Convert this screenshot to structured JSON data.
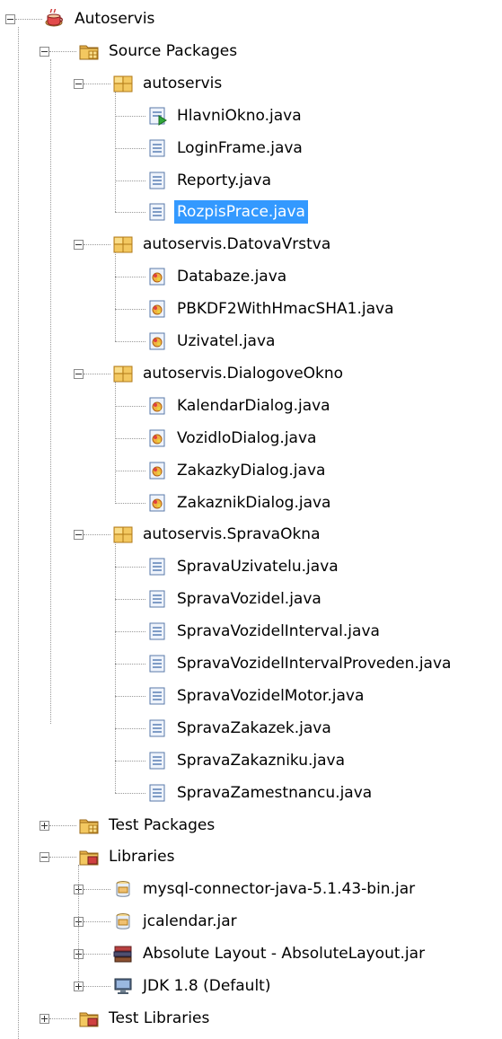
{
  "project": {
    "label": "Autoservis",
    "icon": "coffee-cup-project-icon"
  },
  "source_packages": {
    "label": "Source Packages",
    "icon": "source-packages-folder-icon",
    "packages": [
      {
        "label": "autoservis",
        "files": [
          {
            "label": "HlavniOkno.java",
            "icon": "main-class-icon"
          },
          {
            "label": "LoginFrame.java",
            "icon": "java-form-icon"
          },
          {
            "label": "Reporty.java",
            "icon": "java-form-icon"
          },
          {
            "label": "RozpisPrace.java",
            "icon": "java-form-icon",
            "selected": true
          }
        ]
      },
      {
        "label": "autoservis.DatovaVrstva",
        "files": [
          {
            "label": "Databaze.java",
            "icon": "java-class-icon"
          },
          {
            "label": "PBKDF2WithHmacSHA1.java",
            "icon": "java-class-icon"
          },
          {
            "label": "Uzivatel.java",
            "icon": "java-class-icon"
          }
        ]
      },
      {
        "label": "autoservis.DialogoveOkno",
        "files": [
          {
            "label": "KalendarDialog.java",
            "icon": "java-class-icon"
          },
          {
            "label": "VozidloDialog.java",
            "icon": "java-class-icon"
          },
          {
            "label": "ZakazkyDialog.java",
            "icon": "java-class-icon"
          },
          {
            "label": "ZakaznikDialog.java",
            "icon": "java-class-icon"
          }
        ]
      },
      {
        "label": "autoservis.SpravaOkna",
        "files": [
          {
            "label": "SpravaUzivatelu.java",
            "icon": "java-form-icon"
          },
          {
            "label": "SpravaVozidel.java",
            "icon": "java-form-icon"
          },
          {
            "label": "SpravaVozidelInterval.java",
            "icon": "java-form-icon"
          },
          {
            "label": "SpravaVozidelIntervalProveden.java",
            "icon": "java-form-icon"
          },
          {
            "label": "SpravaVozidelMotor.java",
            "icon": "java-form-icon"
          },
          {
            "label": "SpravaZakazek.java",
            "icon": "java-form-icon"
          },
          {
            "label": "SpravaZakazniku.java",
            "icon": "java-form-icon"
          },
          {
            "label": "SpravaZamestnancu.java",
            "icon": "java-form-icon"
          }
        ]
      }
    ]
  },
  "test_packages": {
    "label": "Test Packages",
    "icon": "test-packages-folder-icon"
  },
  "libraries": {
    "label": "Libraries",
    "icon": "libraries-folder-icon",
    "items": [
      {
        "label": "mysql-connector-java-5.1.43-bin.jar",
        "icon": "jar-icon"
      },
      {
        "label": "jcalendar.jar",
        "icon": "jar-icon"
      },
      {
        "label": "Absolute Layout - AbsoluteLayout.jar",
        "icon": "library-books-icon"
      },
      {
        "label": "JDK 1.8 (Default)",
        "icon": "jdk-monitor-icon"
      }
    ]
  },
  "test_libraries": {
    "label": "Test Libraries",
    "icon": "test-libraries-folder-icon"
  },
  "colors": {
    "selection": "#3399ff",
    "package": "#f0c040",
    "folder": "#e8b34a"
  }
}
